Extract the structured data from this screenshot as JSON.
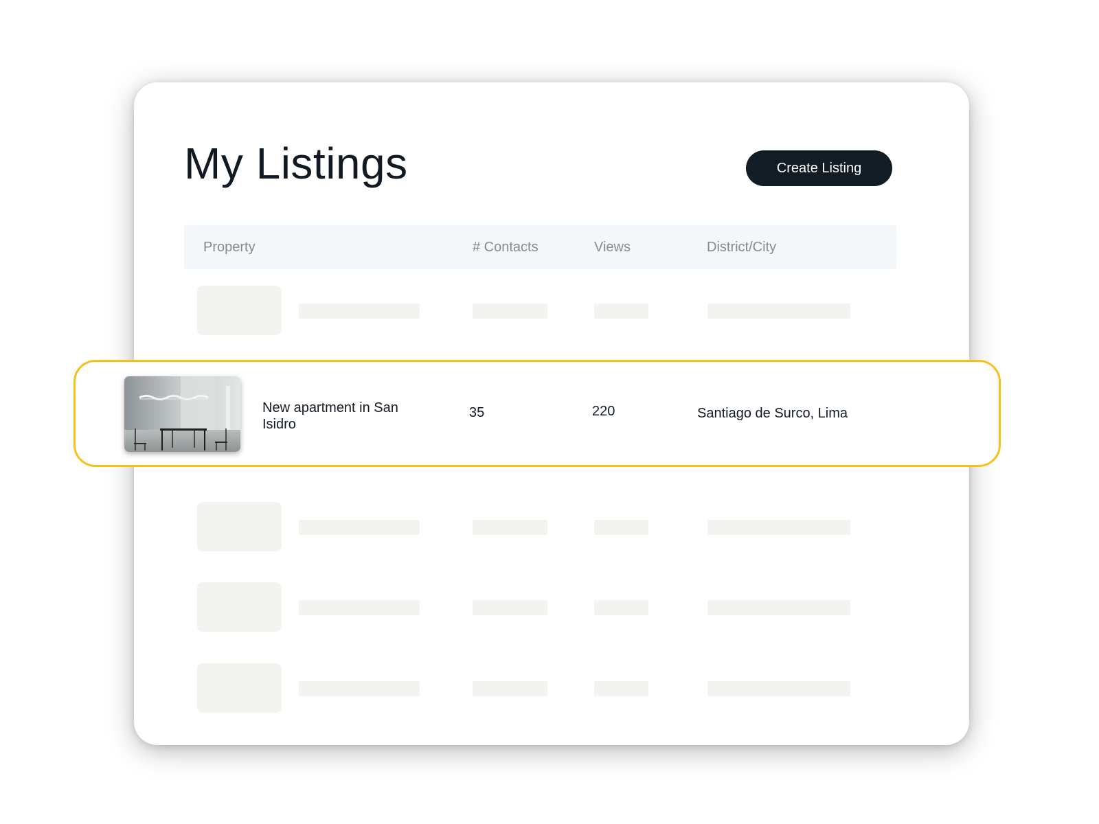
{
  "page": {
    "title": "My Listings",
    "create_button_label": "Create Listing"
  },
  "table": {
    "columns": [
      "Property",
      "# Contacts",
      "Views",
      "District/City"
    ]
  },
  "highlighted_listing": {
    "property": "New apartment in San Isidro",
    "contacts": "35",
    "views": "220",
    "district_city": "Santiago de Surco, Lima"
  },
  "colors": {
    "highlight_border": "#f6c21a",
    "button_background": "#121c24",
    "header_background": "#f3f7fa",
    "skeleton": "#f3f3ef"
  }
}
